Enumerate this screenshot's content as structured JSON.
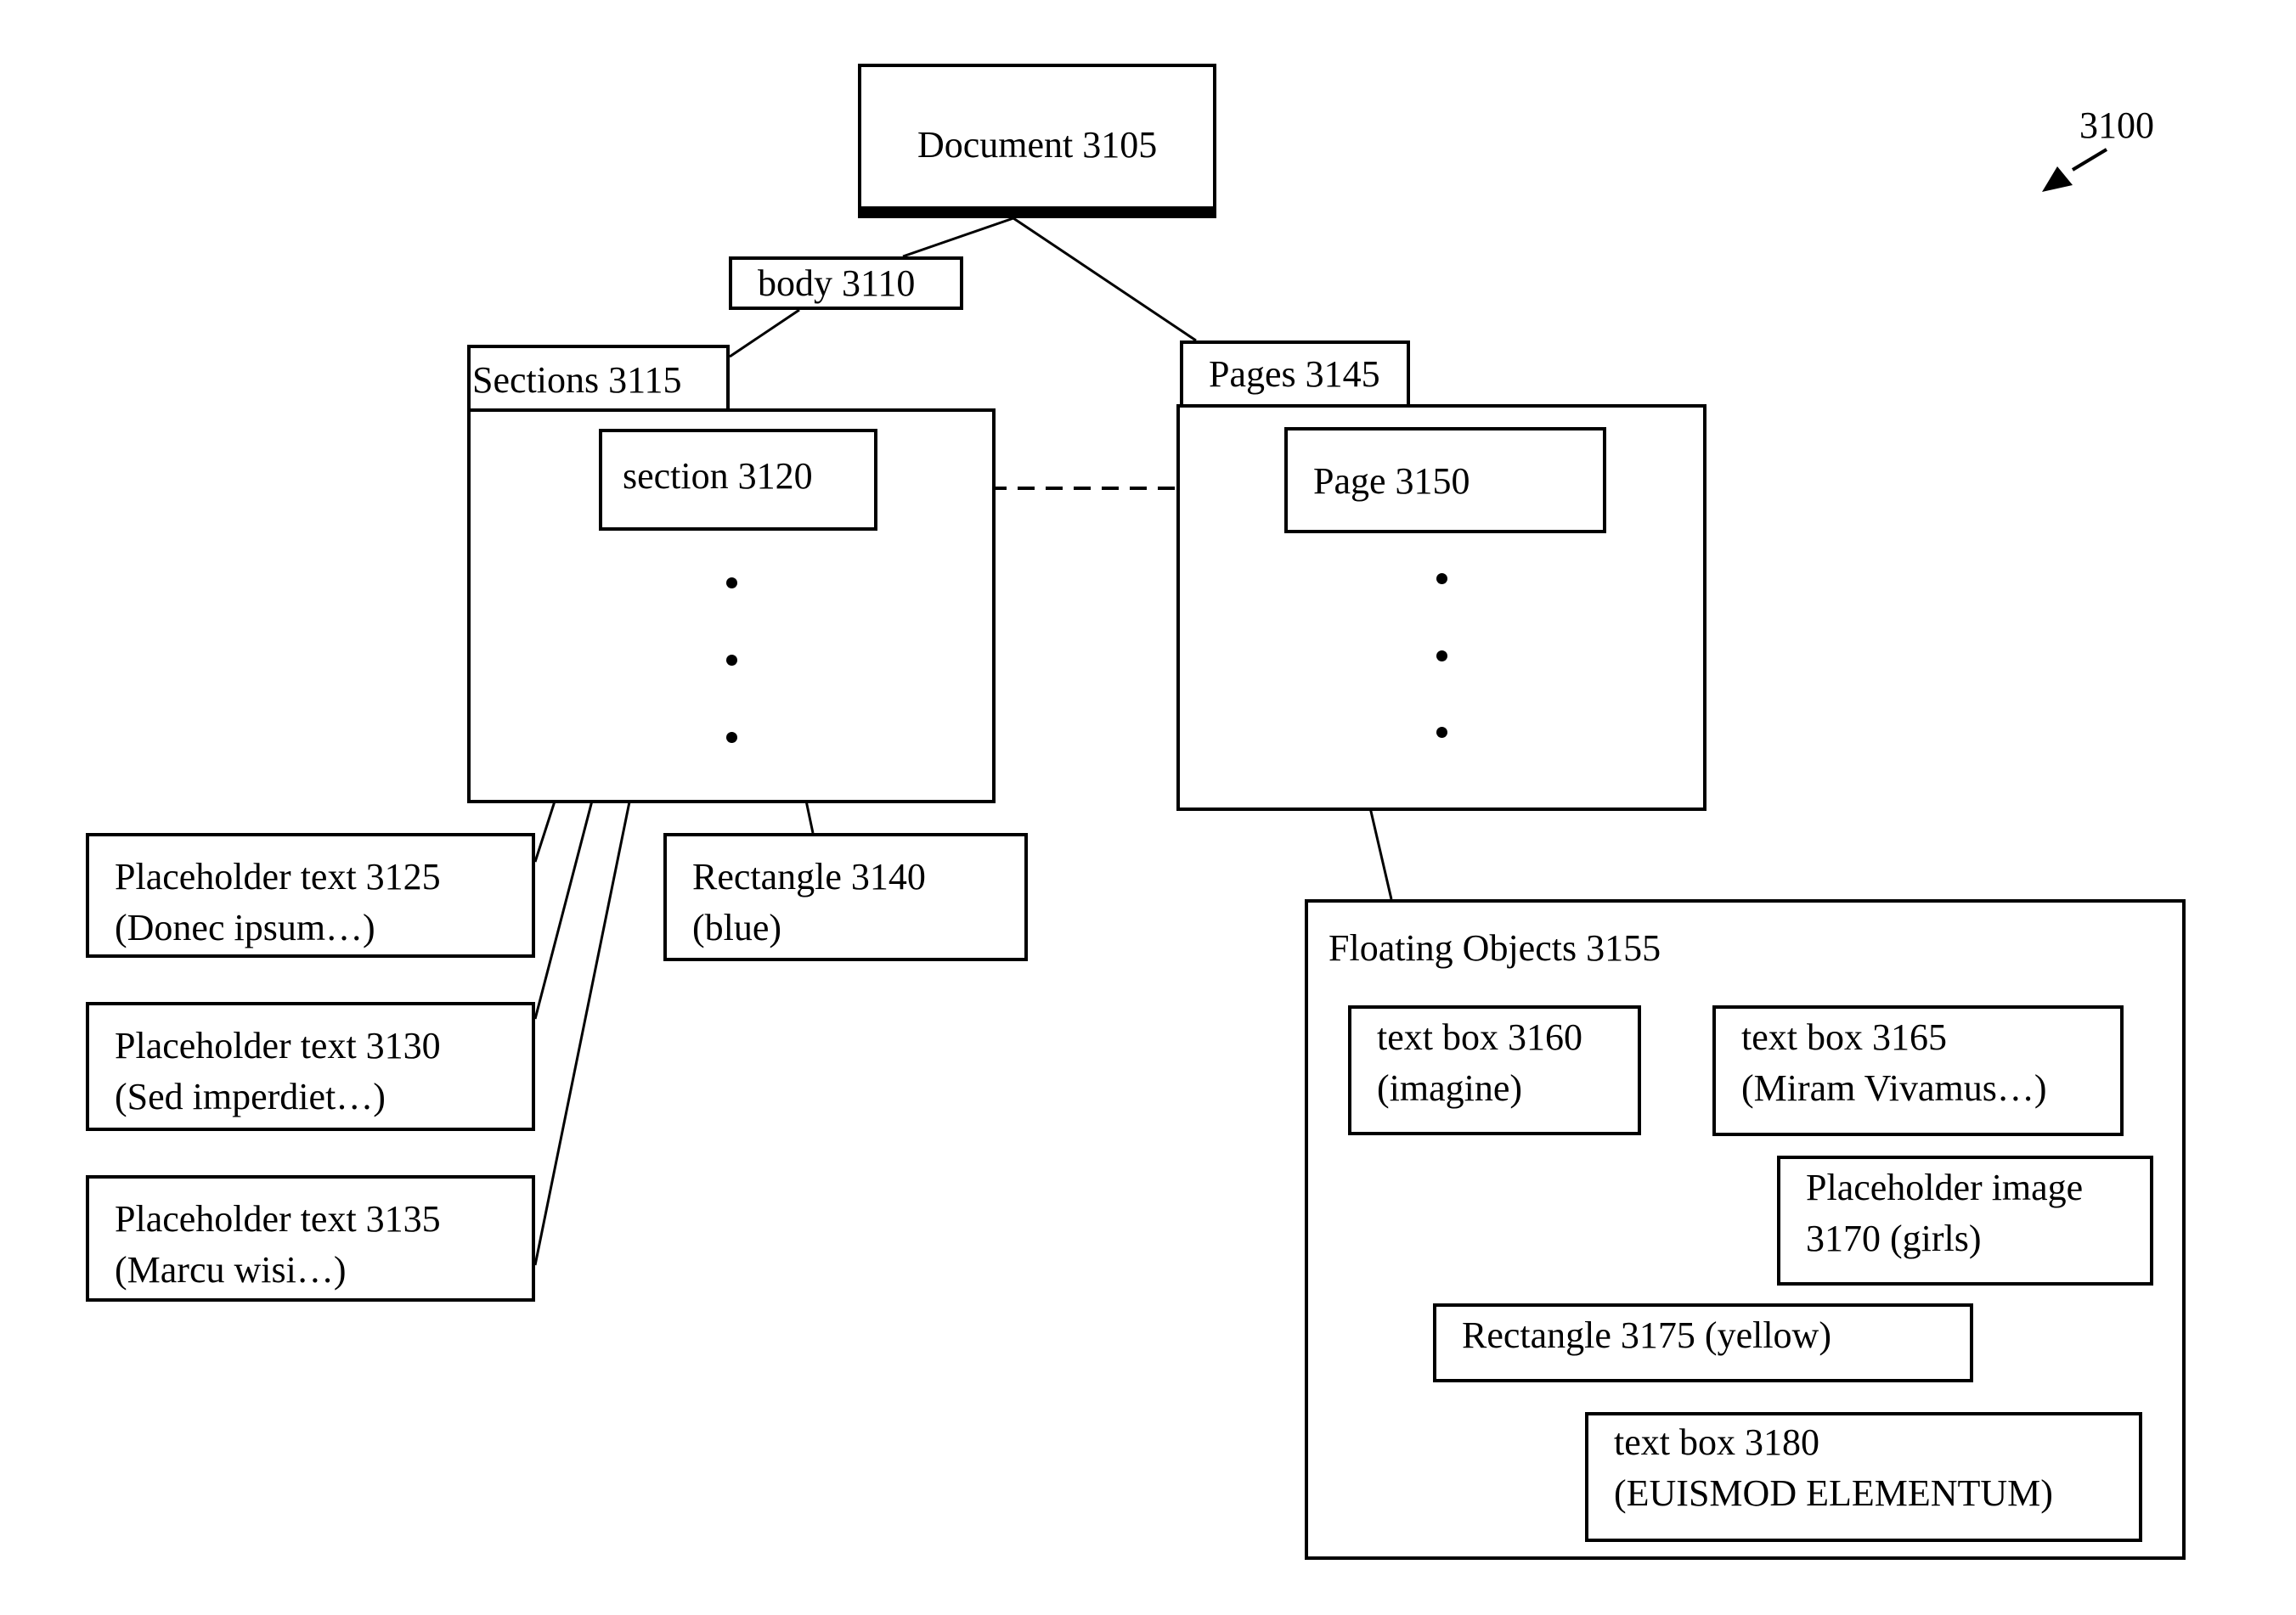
{
  "figure_ref": "3100",
  "nodes": {
    "document": "Document 3105",
    "body": "body 3110",
    "sections": "Sections 3115",
    "section": "section 3120",
    "pages": "Pages 3145",
    "page": "Page 3150",
    "ph3125": [
      "Placeholder text 3125",
      "(Donec ipsum…)"
    ],
    "ph3130": [
      "Placeholder text 3130",
      "(Sed imperdiet…)"
    ],
    "ph3135": [
      "Placeholder text 3135",
      "(Marcu wisi…)"
    ],
    "rect3140": [
      "Rectangle 3140",
      "(blue)"
    ],
    "floating": "Floating Objects 3155",
    "tb3160": [
      "text box 3160",
      "(imagine)"
    ],
    "tb3165": [
      "text box 3165",
      "(Miram Vivamus…)"
    ],
    "img3170": [
      "Placeholder image",
      "3170 (girls)"
    ],
    "rect3175": "Rectangle 3175 (yellow)",
    "tb3180": [
      "text box 3180",
      "(EUISMOD ELEMENTUM)"
    ]
  },
  "edges": [
    {
      "from": "document",
      "to": "body"
    },
    {
      "from": "body",
      "to": "sections"
    },
    {
      "from": "document",
      "to": "pages"
    },
    {
      "from": "section",
      "to": "ph3125"
    },
    {
      "from": "section",
      "to": "ph3130"
    },
    {
      "from": "section",
      "to": "ph3135"
    },
    {
      "from": "section",
      "to": "rect3140"
    },
    {
      "from": "page",
      "to": "floating"
    },
    {
      "from": "section",
      "to": "page",
      "style": "dashed"
    }
  ]
}
